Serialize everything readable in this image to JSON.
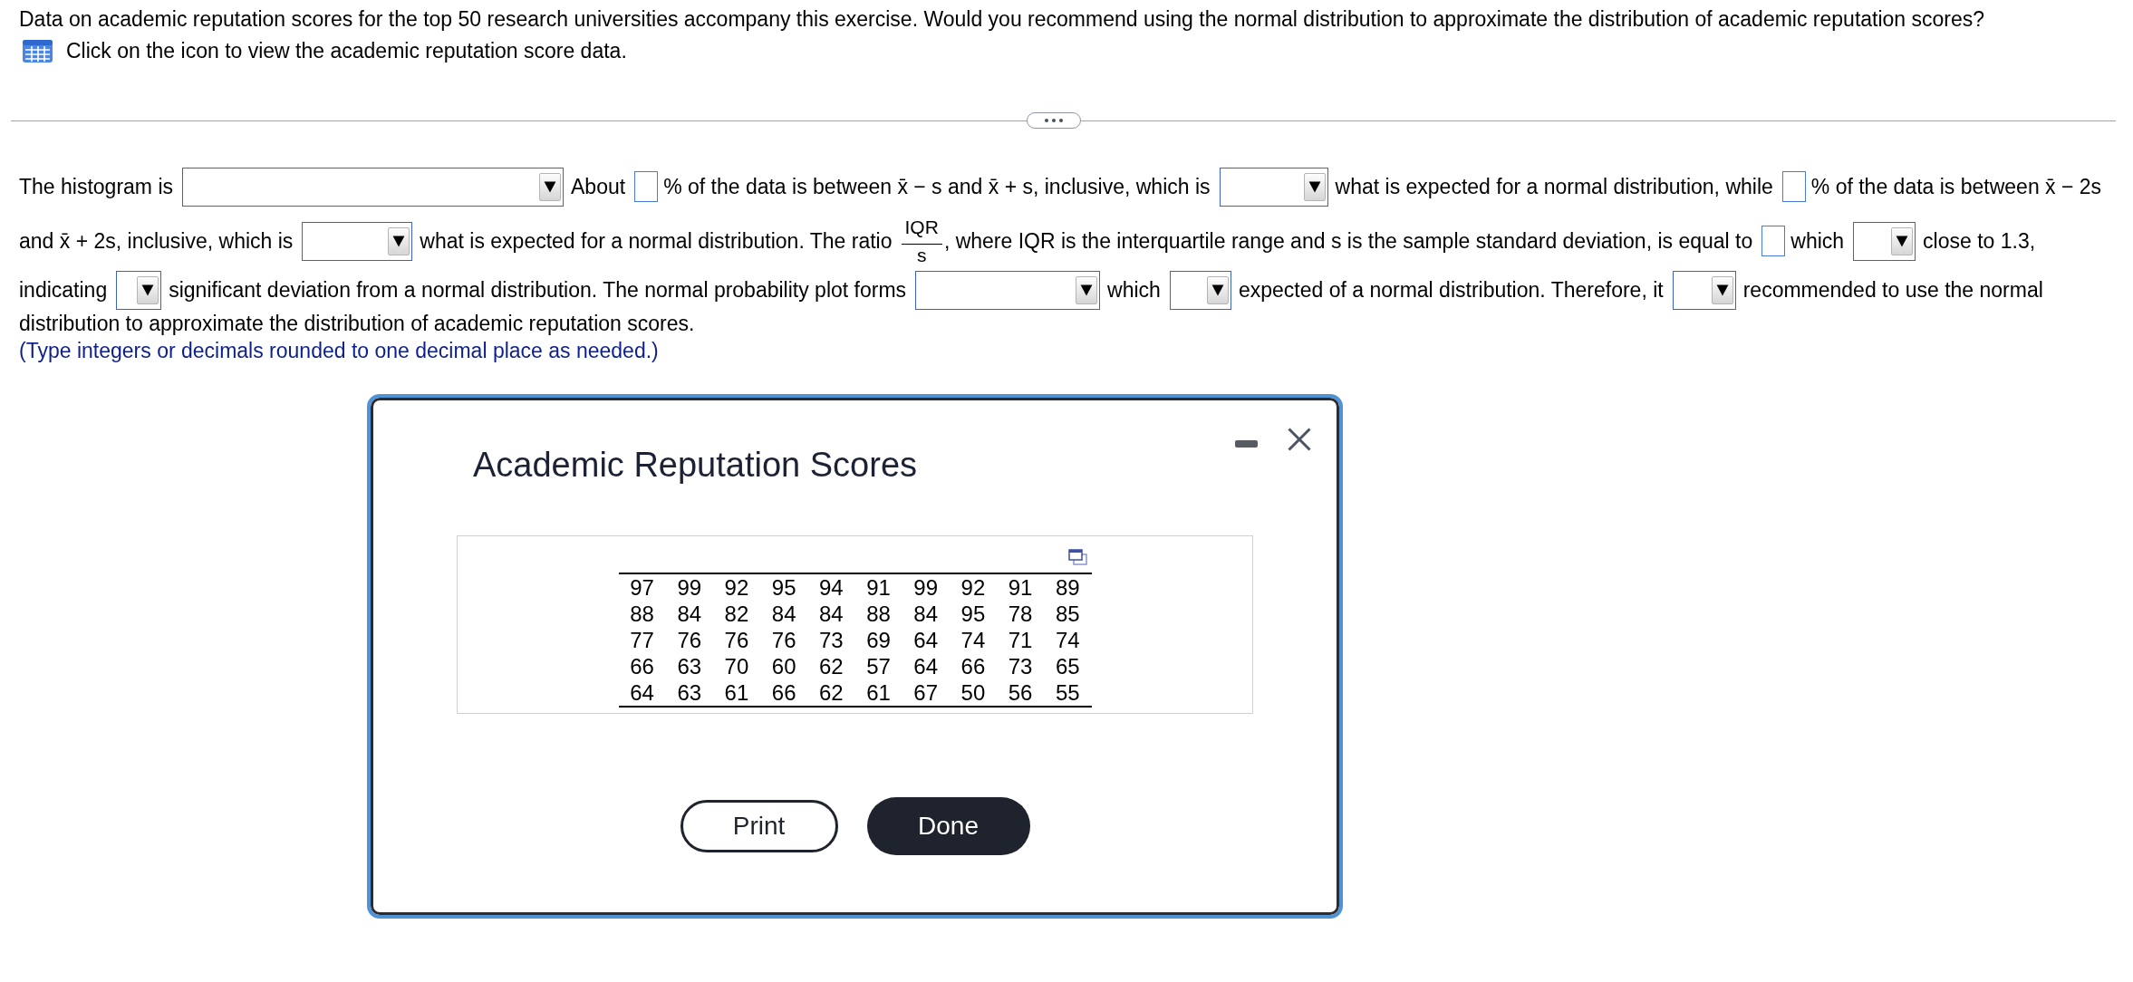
{
  "intro": {
    "text": "Data on academic reputation scores for the top 50 research universities accompany this exercise. Would you recommend using the normal distribution to approximate the distribution of academic reputation scores?",
    "data_link": "Click on the icon to view the academic reputation score data."
  },
  "question": {
    "lines": [
      [
        {
          "kind": "text",
          "text": "The histogram is"
        },
        {
          "kind": "dropdown"
        },
        {
          "kind": "text",
          "text": "About"
        },
        {
          "kind": "blank"
        },
        {
          "kind": "text",
          "text": "% of the data is between x̄ − s and x̄ + s, inclusive, which is"
        },
        {
          "kind": "dropdown"
        },
        {
          "kind": "text",
          "text": "what is expected for a normal distribution, while"
        },
        {
          "kind": "blank"
        },
        {
          "kind": "text",
          "text": "% of the data is between x̄ − 2s"
        }
      ],
      [
        {
          "kind": "text",
          "text": "and x̄ + 2s, inclusive, which is"
        },
        {
          "kind": "dropdown"
        },
        {
          "kind": "text",
          "text": "what is expected for a normal distribution. The ratio"
        },
        {
          "kind": "fraction",
          "numerator": "IQR",
          "denominator": "s"
        },
        {
          "kind": "text",
          "text": ", where IQR is the interquartile range and s is the sample standard deviation, is equal to"
        },
        {
          "kind": "blank"
        },
        {
          "kind": "text",
          "text": "which"
        },
        {
          "kind": "dropdown"
        },
        {
          "kind": "text",
          "text": "close to 1.3,"
        }
      ],
      [
        {
          "kind": "text",
          "text": "indicating"
        },
        {
          "kind": "dropdown"
        },
        {
          "kind": "text",
          "text": "significant deviation from a normal distribution. The normal probability plot forms"
        },
        {
          "kind": "dropdown"
        },
        {
          "kind": "text",
          "text": "which"
        },
        {
          "kind": "dropdown"
        },
        {
          "kind": "text",
          "text": "expected of a normal distribution. Therefore, it"
        },
        {
          "kind": "dropdown"
        },
        {
          "kind": "text",
          "text": "recommended to use the normal"
        }
      ],
      [
        {
          "kind": "text",
          "text": "distribution to approximate the distribution of academic reputation scores."
        }
      ]
    ],
    "hint": "(Type integers or decimals rounded to one decimal place as needed.)"
  },
  "dialog": {
    "title": "Academic Reputation Scores",
    "table": {
      "rows": [
        [
          "97",
          "99",
          "92",
          "95",
          "94",
          "91",
          "99",
          "92",
          "91",
          "89"
        ],
        [
          "88",
          "84",
          "82",
          "84",
          "84",
          "88",
          "84",
          "95",
          "78",
          "85"
        ],
        [
          "77",
          "76",
          "76",
          "76",
          "73",
          "69",
          "64",
          "74",
          "71",
          "74"
        ],
        [
          "66",
          "63",
          "70",
          "60",
          "62",
          "57",
          "64",
          "66",
          "73",
          "65"
        ],
        [
          "64",
          "63",
          "61",
          "66",
          "62",
          "61",
          "67",
          "50",
          "56",
          "55"
        ]
      ]
    },
    "buttons": [
      {
        "label": "Print",
        "kind": "outline"
      },
      {
        "label": "Done",
        "kind": "filled"
      }
    ]
  }
}
